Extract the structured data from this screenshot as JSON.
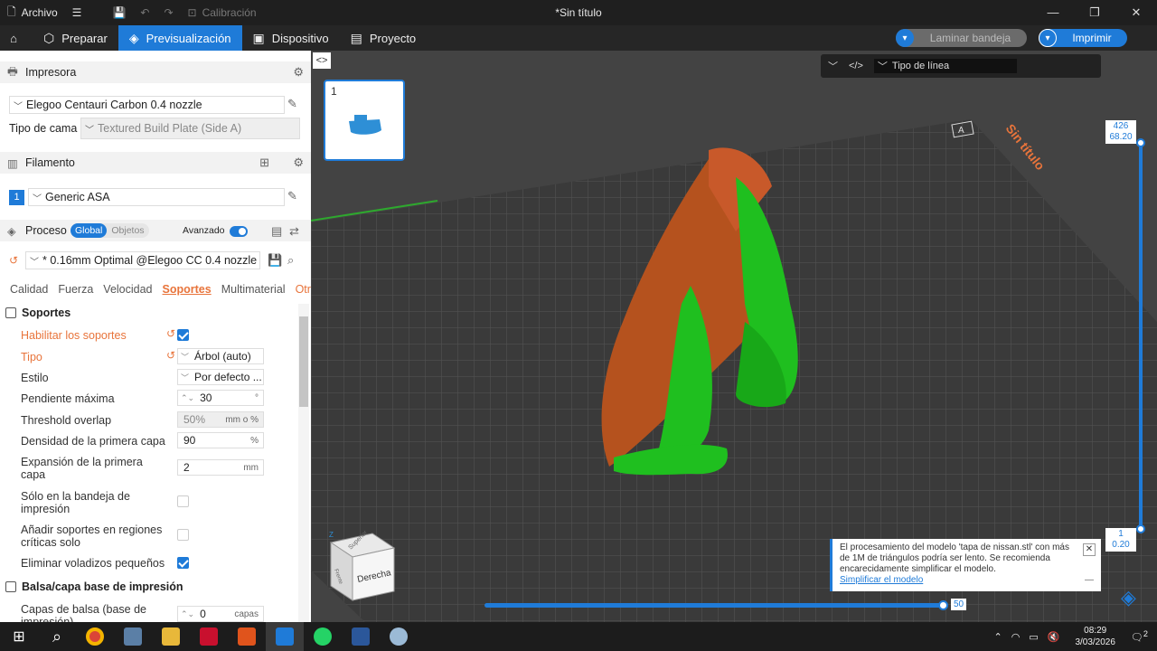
{
  "titlebar": {
    "file_menu": "Archivo",
    "calibration": "Calibración",
    "title": "*Sin título"
  },
  "tabs": [
    {
      "label": "Preparar"
    },
    {
      "label": "Previsualización"
    },
    {
      "label": "Dispositivo"
    },
    {
      "label": "Proyecto"
    }
  ],
  "actions": {
    "slice": "Laminar bandeja",
    "print": "Imprimir"
  },
  "printer": {
    "section": "Impresora",
    "name": "Elegoo Centauri Carbon 0.4 nozzle",
    "bed_label": "Tipo de cama",
    "bed_value": "Textured Build Plate (Side A)"
  },
  "filament": {
    "section": "Filamento",
    "slot": "1",
    "name": "Generic ASA"
  },
  "process": {
    "section": "Proceso",
    "scope_global": "Global",
    "scope_objects": "Objetos",
    "advanced": "Avanzado",
    "preset": "* 0.16mm Optimal @Elegoo CC 0.4 nozzle"
  },
  "subtabs": [
    "Calidad",
    "Fuerza",
    "Velocidad",
    "Soportes",
    "Multimaterial",
    "Otros"
  ],
  "supports": {
    "heading": "Soportes",
    "enable_label": "Habilitar los soportes",
    "type_label": "Tipo",
    "type_value": "Árbol (auto)",
    "style_label": "Estilo",
    "style_value": "Por defecto ...",
    "max_slope_label": "Pendiente máxima",
    "max_slope_value": "30",
    "max_slope_unit": "°",
    "threshold_label": "Threshold overlap",
    "threshold_value": "50%",
    "threshold_unit": "mm o %",
    "first_density_label": "Densidad de la primera capa",
    "first_density_value": "90",
    "first_density_unit": "%",
    "first_expansion_label": "Expansión de la primera capa",
    "first_expansion_value": "2",
    "first_expansion_unit": "mm",
    "on_plate_label": "Sólo en la bandeja de impresión",
    "critical_label": "Añadir soportes en regiones críticas solo",
    "remove_small_label": "Eliminar voladizos pequeños"
  },
  "raft": {
    "heading": "Balsa/capa base de impresión",
    "layers_label": "Capas de balsa (base de impresión)",
    "layers_value": "0",
    "layers_unit": "capas"
  },
  "viewport": {
    "plate_number": "1",
    "line_type": "Tipo de línea",
    "plate_name": "Sin título",
    "plate_letter": "A",
    "top_layer": "426",
    "top_height": "68.20",
    "bottom_layer": "1",
    "bottom_height": "0.20",
    "h_slider_value": "50",
    "cube_front": "Derecha",
    "cube_top": "Superior",
    "cube_left": "Frente",
    "axis_z": "Z",
    "notice_text": "El procesamiento del modelo 'tapa de nissan.stl' con más de 1M de triángulos podría ser lento. Se recomienda encarecidamente simplificar el modelo.",
    "notice_link": "Simplificar el modelo"
  },
  "taskbar": {
    "time": "08:29",
    "date": "3/03/2026",
    "notif": "2"
  },
  "colors": {
    "accent": "#1f7bd8",
    "orange": "#e8743b",
    "support_green": "#1fbf1f",
    "model_orange": "#b5521e"
  }
}
